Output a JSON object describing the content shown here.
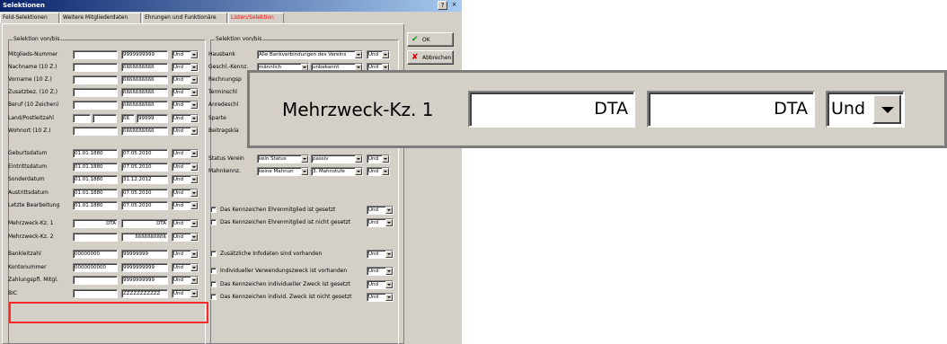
{
  "window": {
    "title": "Selektionen",
    "help_label": "?",
    "close_label": "×"
  },
  "tabs": [
    {
      "label": "Feld-Selektionen"
    },
    {
      "label": "Weitere Mitgliederdaten"
    },
    {
      "label": "Ehrungen und Funktionäre"
    },
    {
      "label": "Listen/Selektion"
    }
  ],
  "left_group": {
    "title": "Selektion von/bis"
  },
  "right_group": {
    "title": "Selektion von/bis"
  },
  "left_rows": [
    {
      "label": "Mitglieds-Nummer",
      "from": "",
      "to": "9999999999",
      "op": "Und"
    },
    {
      "label": "Nachname (10 Z.)",
      "from": "",
      "to": "ßßßßßßßßßß",
      "op": "Und"
    },
    {
      "label": "Vorname (10 Z.)",
      "from": "",
      "to": "ßßßßßßßßßß",
      "op": "Und"
    },
    {
      "label": "Zusatzbez. (10 Z.)",
      "from": "",
      "to": "ßßßßßßßßßß",
      "op": "Und"
    },
    {
      "label": "Beruf (10 Zeichen)",
      "from": "",
      "to": "ßßßßßßßßßß",
      "op": "Und"
    },
    {
      "label": "Land/Postleitzahl",
      "from": "",
      "to": "99999",
      "op": "Und",
      "country_to": "ßß"
    },
    {
      "label": "Wohnort (10 Z.)",
      "from": "",
      "to": "ßßßßßßßßßß",
      "op": "Und"
    },
    {
      "label": "Geburtsdatum",
      "from": "01.01.1880",
      "to": "07.05.2010",
      "op": "Und"
    },
    {
      "label": "Eintrittsdatum",
      "from": "01.01.1880",
      "to": "07.05.2010",
      "op": "Und"
    },
    {
      "label": "Sonderdatum",
      "from": "01.01.1880",
      "to": "31.12.2012",
      "op": "Und"
    },
    {
      "label": "Austrittsdatum",
      "from": "01.01.1880",
      "to": "07.05.2010",
      "op": "Und"
    },
    {
      "label": "Letzte Bearbeitung",
      "from": "01.01.1880",
      "to": "07.05.2010",
      "op": "Und"
    },
    {
      "label": "Mehrzweck-Kz. 1",
      "from": "DTA",
      "to": "DTA",
      "op": "Und"
    },
    {
      "label": "Mehrzweck-Kz. 2",
      "from": "",
      "to": "ßßßßßßßßßß",
      "op": "Und"
    },
    {
      "label": "Bankleitzahl",
      "from": "00000000",
      "to": "99999999",
      "op": "Und"
    },
    {
      "label": "Kontonummer",
      "from": "0000000000",
      "to": "9999999999",
      "op": "Und"
    },
    {
      "label": "Zahlungspfl. Mitgl.",
      "from": "",
      "to": "9999999999",
      "op": "Und"
    },
    {
      "label": "BIC",
      "from": "",
      "to": "ZZZZZZZZZZZ",
      "op": "Und"
    }
  ],
  "right_top": {
    "hausbank_label": "Hausbank",
    "hausbank_value": "Alle Bankverbindungen des Vereins",
    "hausbank_op": "Und",
    "geschl_label": "Geschl.-Kennz.",
    "geschl_from": "männlich",
    "geschl_to": "unbekannt",
    "geschl_op": "Und",
    "partial_labels": [
      "Rechnungsp",
      "Terminschl",
      "Anredeschl",
      "Sparte",
      "Beitragskla"
    ],
    "status_label": "Status Verein",
    "status_from": "kein Status",
    "status_to": "passiv",
    "status_op": "Und",
    "mahn_label": "Mahnkennz.",
    "mahn_from": "keine Mahnun",
    "mahn_to": "3. Mahnstufe",
    "mahn_op": "Und"
  },
  "checkboxes": [
    {
      "label": "Das Kennzeichen Ehrenmitglied ist gesetzt",
      "op": "Und"
    },
    {
      "label": "Das Kennzeichen Ehrenmitglied ist nicht gesetzt",
      "op": "Und"
    },
    {
      "label": "Zusätzliche Infodaten sind vorhanden",
      "op": "Und"
    },
    {
      "label": "Individueller Verwendungszweck ist vorhanden",
      "op": "Und"
    },
    {
      "label": "Das Kennzeichen individueller Zweck ist gesetzt",
      "op": "Und"
    },
    {
      "label": "Das Kennzeichen individ. Zweck ist nicht gesetzt",
      "op": "Und"
    }
  ],
  "buttons": {
    "ok": "OK",
    "cancel": "Abbrechen"
  },
  "zoom": {
    "label": "Mehrzweck-Kz. 1",
    "from": "DTA",
    "to": "DTA",
    "op": "Und"
  },
  "colors": {
    "highlight": "#ff2a2a",
    "title_bar": "#0a246a",
    "ok_check": "#00a000",
    "cancel_x": "#cc0000"
  }
}
